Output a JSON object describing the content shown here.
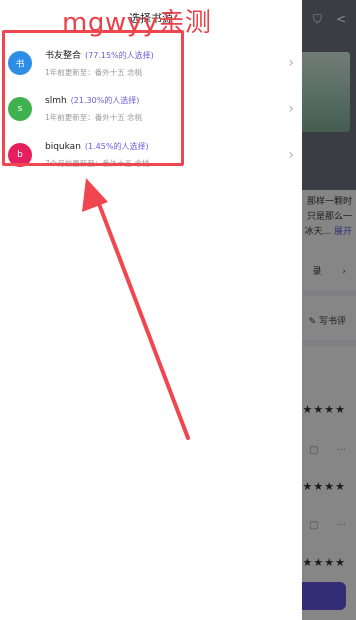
{
  "background": {
    "intro_lines": [
      "那样一颗时",
      "只是那么一",
      "冰天... "
    ],
    "intro_more": "展开",
    "catalog_label": "录",
    "review_label": "写书评"
  },
  "drawer": {
    "title": "选择书源",
    "sources": [
      {
        "avatar": "书",
        "name": "书友整合",
        "percent": "(77.15%的人选择)",
        "update": "1年前更新至：番外十五 念桃",
        "color": "#2e8de6"
      },
      {
        "avatar": "s",
        "name": "slmh",
        "percent": "(21.30%的人选择)",
        "update": "1年前更新至：番外十五 念桃",
        "color": "#3fb14e"
      },
      {
        "avatar": "b",
        "name": "biqukan",
        "percent": "(1.45%的人选择)",
        "update": "7个月前更新至：番外十五 念桃",
        "color": "#e51f5e"
      }
    ]
  },
  "annotation": {
    "watermark": "mgwyy亲测"
  }
}
